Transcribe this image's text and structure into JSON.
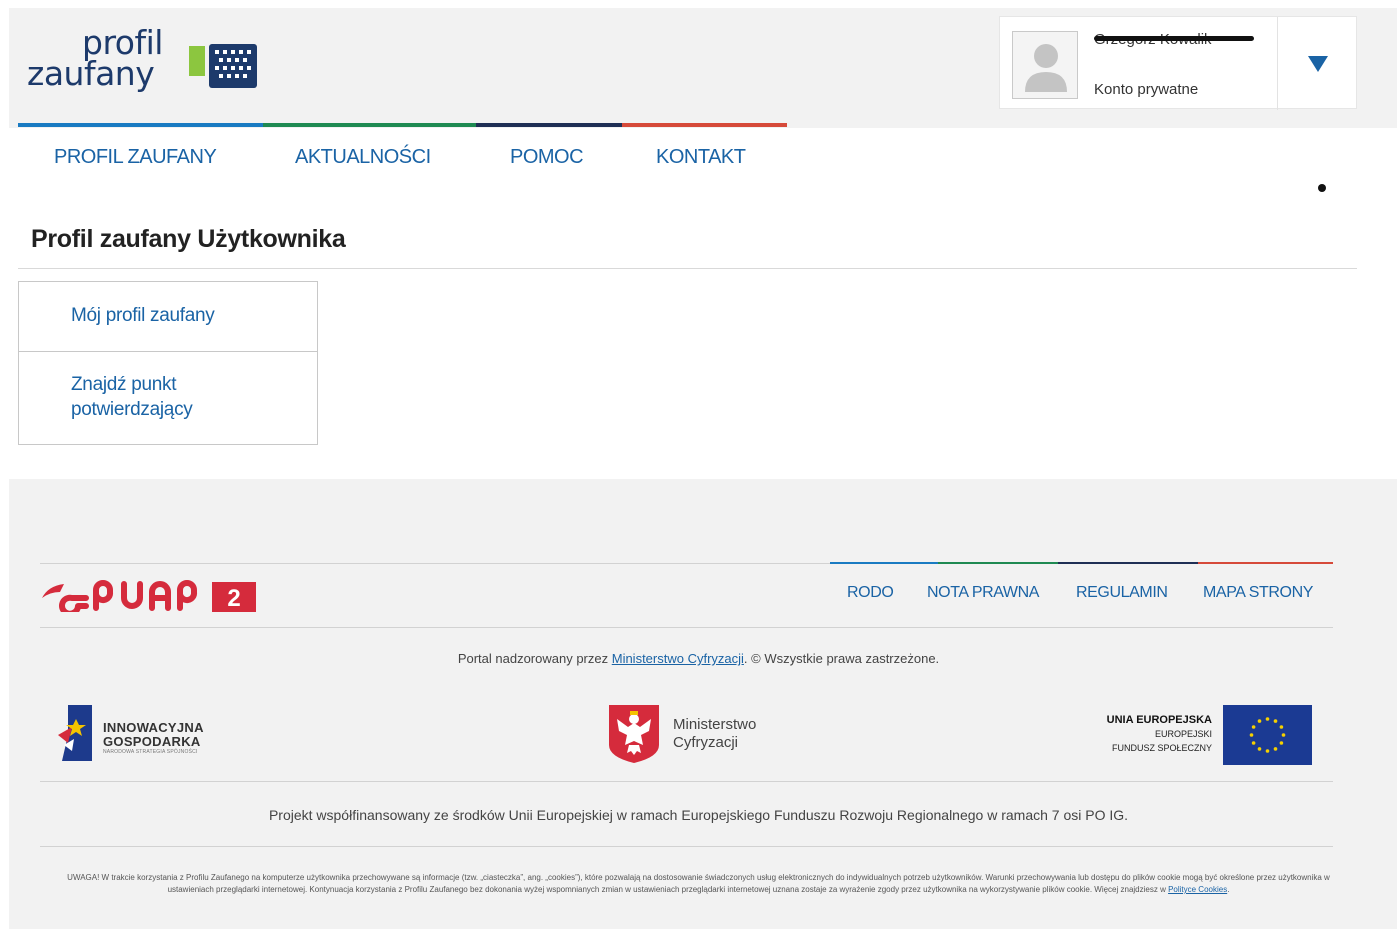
{
  "header": {
    "logo": {
      "line1": "profil",
      "line2": "zaufany"
    },
    "user": {
      "name": "Grzegorz Kowalik",
      "account_type": "Konto prywatne"
    },
    "accent_colors": [
      "#1a7bc2",
      "#1f8a52",
      "#1f2f55",
      "#d64a3a"
    ]
  },
  "nav": {
    "items": [
      {
        "label": "PROFIL ZAUFANY"
      },
      {
        "label": "AKTUALNOŚCI"
      },
      {
        "label": "POMOC"
      },
      {
        "label": "KONTAKT"
      }
    ]
  },
  "main": {
    "title": "Profil zaufany Użytkownika",
    "side_menu": [
      {
        "label": "Mój profil zaufany"
      },
      {
        "label_line1": "Znajdź punkt",
        "label_line2": "potwierdzający"
      }
    ]
  },
  "footer": {
    "links": [
      {
        "label": "RODO"
      },
      {
        "label": "NOTA PRAWNA"
      },
      {
        "label": "REGULAMIN"
      },
      {
        "label": "MAPA STRONY"
      }
    ],
    "supervision": {
      "prefix": "Portal nadzorowany przez ",
      "link": "Ministerstwo Cyfryzacji",
      "suffix": ". © Wszystkie prawa zastrzeżone."
    },
    "partners": {
      "ig_line1": "INNOWACYJNA",
      "ig_line2": "GOSPODARKA",
      "ig_line3": "NARODOWA STRATEGIA SPÓJNOŚCI",
      "mc_line1": "Ministerstwo",
      "mc_line2": "Cyfryzacji",
      "ue_line1": "UNIA EUROPEJSKA",
      "ue_line2": "EUROPEJSKI",
      "ue_line3": "FUNDUSZ SPOŁECZNY"
    },
    "project": "Projekt współfinansowany ze środków Unii Europejskiej w ramach Europejskiego Funduszu Rozwoju Regionalnego w ramach 7 osi PO IG.",
    "cookie_notice": {
      "text": "UWAGA! W trakcie korzystania z Profilu Zaufanego na komputerze użytkownika przechowywane są informacje (tzw. „ciasteczka”, ang. „cookies”), które pozwalają na dostosowanie świadczonych usług elektronicznych do indywidualnych potrzeb użytkowników. Warunki przechowywania lub dostępu do plików cookie mogą być określone przez użytkownika w ustawieniach przeglądarki internetowej. Kontynuacja korzystania z Profilu Zaufanego bez dokonania wyżej wspomnianych zmian w ustawieniach przeglądarki internetowej uznana zostaje za wyrażenie zgody przez użytkownika na wykorzystywanie plików cookie. Więcej znajdziesz w ",
      "link": "Polityce Cookies",
      "end": "."
    }
  }
}
